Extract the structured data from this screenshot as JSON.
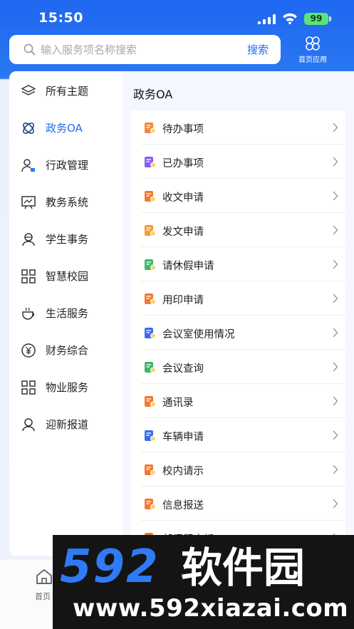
{
  "status_bar": {
    "time": "15:50",
    "battery": "99"
  },
  "search": {
    "placeholder": "输入服务项名称搜索",
    "button": "搜索"
  },
  "home_apps": {
    "label": "首页应用"
  },
  "sidebar": {
    "items": [
      {
        "label": "所有主题",
        "icon": "layers-icon"
      },
      {
        "label": "政务OA",
        "icon": "orbit-icon",
        "active": true
      },
      {
        "label": "行政管理",
        "icon": "person-admin-icon"
      },
      {
        "label": "教务系统",
        "icon": "teaching-board-icon"
      },
      {
        "label": "学生事务",
        "icon": "student-icon"
      },
      {
        "label": "智慧校园",
        "icon": "grid-apps-icon"
      },
      {
        "label": "生活服务",
        "icon": "cup-icon"
      },
      {
        "label": "财务综合",
        "icon": "yen-circle-icon"
      },
      {
        "label": "物业服务",
        "icon": "grid-apps-icon"
      },
      {
        "label": "迎新报道",
        "icon": "person-icon"
      }
    ]
  },
  "content": {
    "title": "政务OA",
    "items": [
      {
        "label": "待办事项",
        "icon": "todo-icon",
        "color": "#f0883a"
      },
      {
        "label": "已办事项",
        "icon": "done-icon",
        "color": "#8a5cf0"
      },
      {
        "label": "收文申请",
        "icon": "receive-doc-icon",
        "color": "#f07a30"
      },
      {
        "label": "发文申请",
        "icon": "send-doc-icon",
        "color": "#f0a030"
      },
      {
        "label": "请休假申请",
        "icon": "leave-icon",
        "color": "#3cb86a"
      },
      {
        "label": "用印申请",
        "icon": "seal-icon",
        "color": "#f07a30"
      },
      {
        "label": "会议室使用情况",
        "icon": "meeting-room-icon",
        "color": "#3a6cf0"
      },
      {
        "label": "会议查询",
        "icon": "meeting-search-icon",
        "color": "#3cb86a"
      },
      {
        "label": "通讯录",
        "icon": "contacts-icon",
        "color": "#f07a30"
      },
      {
        "label": "车辆申请",
        "icon": "car-icon",
        "color": "#3a6cf0"
      },
      {
        "label": "校内请示",
        "icon": "request-icon",
        "color": "#f07a30"
      },
      {
        "label": "信息报送",
        "icon": "report-icon",
        "color": "#f07a30"
      },
      {
        "label": "部门留言板",
        "icon": "message-board-icon",
        "color": "#f07a30"
      }
    ]
  },
  "tabbar": {
    "home_label": "首页"
  },
  "watermark": {
    "brand": "592软件园",
    "url": "www.592xiazai.com"
  },
  "colors": {
    "accent": "#1f6ef0",
    "header": "#2a78f2"
  }
}
